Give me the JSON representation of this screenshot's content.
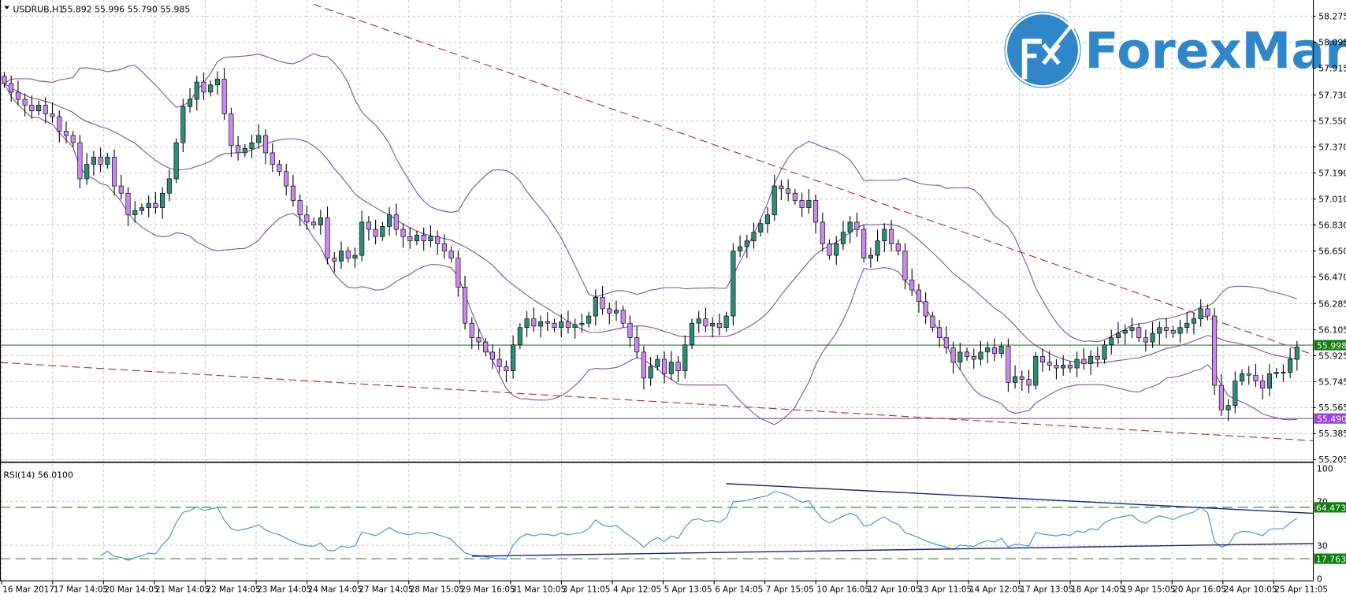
{
  "header": {
    "symbol": "USDRUB,H1",
    "ohlc": "55.892 55.996 55.790 55.985",
    "menu_icon": "triangle-down-icon"
  },
  "logo": {
    "text": "ForexMart",
    "badge": "Fx"
  },
  "rsi": {
    "label": "RSI(14) 56.0100",
    "period": 14
  },
  "colors": {
    "bull": "#2e8b7a",
    "bear": "#cc88ee",
    "bands": "#7b4fa8",
    "trendline": "#a52a2a",
    "rsi_line": "#3a8fd0",
    "rsi_trend": "#1a237e",
    "level": "#1e7e1e",
    "price_label": "#0a7d0a",
    "support_label": "#9b40e0",
    "logo": "#2f87c9"
  },
  "chart_data": [
    {
      "type": "candlestick",
      "title": "USDRUB,H1",
      "ylim": [
        55.205,
        58.275
      ],
      "y_ticks": [
        "58.275",
        "58.095",
        "57.915",
        "57.730",
        "57.550",
        "57.370",
        "57.190",
        "57.010",
        "56.830",
        "56.650",
        "56.470",
        "56.285",
        "56.105",
        "55.925",
        "55.745",
        "55.565",
        "55.385",
        "55.205"
      ],
      "x_ticks": [
        "16 Mar 2017",
        "17 Mar 14:05",
        "20 Mar 14:05",
        "21 Mar 14:05",
        "22 Mar 14:05",
        "23 Mar 14:05",
        "24 Mar 14:05",
        "27 Mar 14:05",
        "28 Mar 15:05",
        "29 Mar 16:05",
        "31 Mar 10:05",
        "3 Apr 11:05",
        "4 Apr 12:05",
        "5 Apr 13:05",
        "6 Apr 14:05",
        "7 Apr 15:05",
        "10 Apr 16:05",
        "12 Apr 10:05",
        "13 Apr 11:05",
        "14 Apr 12:05",
        "17 Apr 13:05",
        "18 Apr 14:05",
        "19 Apr 15:05",
        "20 Apr 16:05",
        "24 Apr 10:05",
        "25 Apr 11:05"
      ],
      "grid": true,
      "closes": [
        57.81,
        57.75,
        57.7,
        57.66,
        57.62,
        57.66,
        57.6,
        57.58,
        57.48,
        57.45,
        57.4,
        57.15,
        57.25,
        57.3,
        57.25,
        57.3,
        57.1,
        57.05,
        56.9,
        56.93,
        56.95,
        56.98,
        56.95,
        57.05,
        57.15,
        57.4,
        57.65,
        57.7,
        57.82,
        57.75,
        57.8,
        57.84,
        57.6,
        57.38,
        57.33,
        57.36,
        57.4,
        57.45,
        57.33,
        57.25,
        57.2,
        57.1,
        57.0,
        56.9,
        56.85,
        56.83,
        56.88,
        56.6,
        56.58,
        56.65,
        56.6,
        56.62,
        56.85,
        56.8,
        56.75,
        56.82,
        56.9,
        56.8,
        56.75,
        56.72,
        56.76,
        56.72,
        56.75,
        56.7,
        56.65,
        56.6,
        56.4,
        56.15,
        56.05,
        56.02,
        55.95,
        55.9,
        55.85,
        55.82,
        56.0,
        56.12,
        56.18,
        56.13,
        56.16,
        56.15,
        56.12,
        56.16,
        56.12,
        56.14,
        56.15,
        56.2,
        56.33,
        56.25,
        56.22,
        56.24,
        56.15,
        56.05,
        55.95,
        55.77,
        55.85,
        55.9,
        55.8,
        55.88,
        55.82,
        56.0,
        56.15,
        56.18,
        56.13,
        56.15,
        56.12,
        56.2,
        56.65,
        56.68,
        56.72,
        56.78,
        56.84,
        56.9,
        57.1,
        57.08,
        57.05,
        57.0,
        56.95,
        57.0,
        56.85,
        56.7,
        56.62,
        56.7,
        56.78,
        56.85,
        56.8,
        56.6,
        56.62,
        56.72,
        56.8,
        56.7,
        56.65,
        56.45,
        56.38,
        56.3,
        56.2,
        56.12,
        56.05,
        55.98,
        55.88,
        55.95,
        55.92,
        55.9,
        55.95,
        55.98,
        55.94,
        55.99,
        55.74,
        55.78,
        55.76,
        55.72,
        55.92,
        55.88,
        55.86,
        55.84,
        55.86,
        55.84,
        55.9,
        55.87,
        55.92,
        55.9,
        56.0,
        56.05,
        56.08,
        56.1,
        56.12,
        56.05,
        56.02,
        56.08,
        56.12,
        56.1,
        56.08,
        56.12,
        56.15,
        56.18,
        56.25,
        56.2,
        55.72,
        55.55,
        55.58,
        55.75,
        55.8,
        55.79,
        55.75,
        55.7,
        55.8,
        55.81,
        55.81,
        55.9,
        55.985
      ],
      "first_open": 57.86,
      "indicators": {
        "bollinger": {
          "period": 20,
          "deviations": 2
        }
      },
      "trendlines": [
        {
          "from": [
            45,
            58.358
          ],
          "to": [
            190.4,
            55.931
          ],
          "style": "dashed"
        },
        {
          "from": [
            -0.6,
            55.878
          ],
          "to": [
            190.4,
            55.336
          ],
          "style": "dashed"
        }
      ],
      "hlines": [
        {
          "price": 55.998,
          "label": "55.998",
          "kind": "current"
        },
        {
          "price": 55.49,
          "label": "55.490",
          "kind": "support"
        }
      ]
    },
    {
      "type": "line",
      "title": "RSI(14) 56.0100",
      "ylim": [
        0,
        100
      ],
      "y_ticks": [
        "100",
        "70",
        "30",
        "0"
      ],
      "levels": [
        {
          "value": 64.4737,
          "label": "64.4737"
        },
        {
          "value": 17.7632,
          "label": "17.7632"
        }
      ],
      "trendlines": [
        {
          "from": [
            105,
            86
          ],
          "to": [
            190.4,
            59
          ]
        },
        {
          "from": [
            68,
            20
          ],
          "to": [
            190.4,
            31.6
          ]
        }
      ]
    }
  ]
}
